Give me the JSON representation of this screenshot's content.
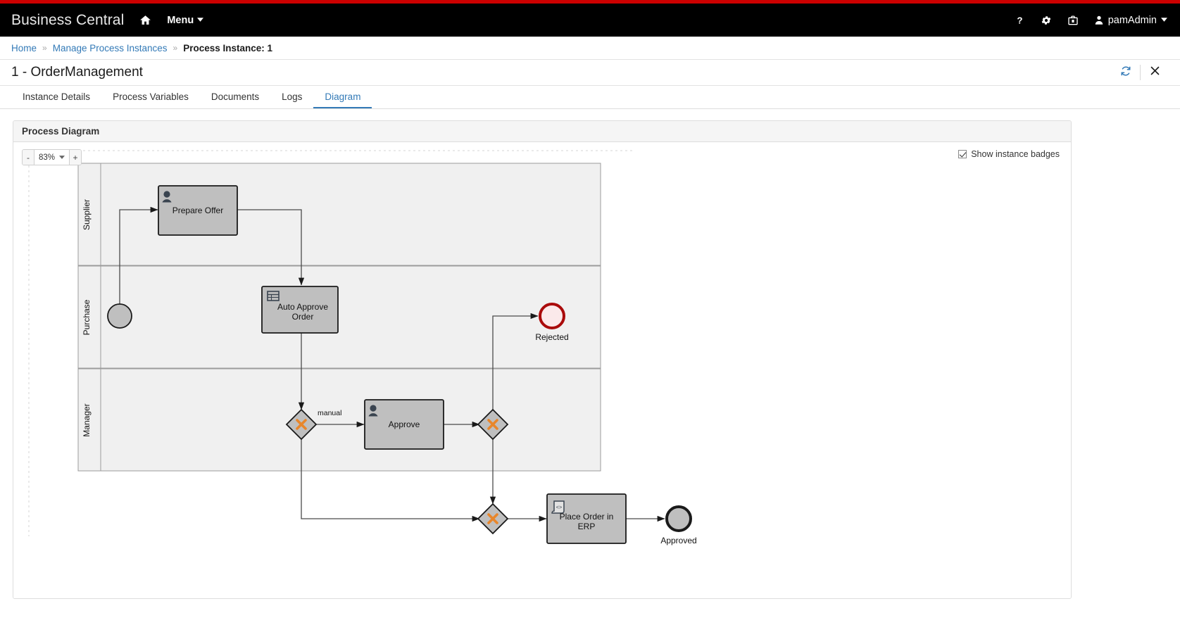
{
  "masthead": {
    "brand": "Business Central",
    "home_icon": "home-icon",
    "menu_label": "Menu",
    "help_icon": "question-mark-icon",
    "settings_icon": "gear-icon",
    "tasks_icon": "briefcase-icon",
    "user_icon": "person-icon",
    "user_name": "pamAdmin",
    "caret": "⌄"
  },
  "breadcrumb": {
    "home": "Home",
    "sep": "»",
    "manage": "Manage Process Instances",
    "current": "Process Instance: 1"
  },
  "titlebar": {
    "title": "1 - OrderManagement",
    "refresh_icon": "refresh-icon",
    "close_icon": "close-icon"
  },
  "tabs": [
    {
      "label": "Instance Details",
      "active": false
    },
    {
      "label": "Process Variables",
      "active": false
    },
    {
      "label": "Documents",
      "active": false
    },
    {
      "label": "Logs",
      "active": false
    },
    {
      "label": "Diagram",
      "active": true
    }
  ],
  "panel": {
    "heading": "Process Diagram",
    "zoom": {
      "minus": "-",
      "level": "83%",
      "caret": "⌄",
      "plus": "+"
    },
    "badges": {
      "label": "Show instance badges",
      "checked": true
    }
  },
  "colors": {
    "accent": "#337ab7",
    "brand_red": "#cc0000",
    "masthead": "#000000",
    "shape_fill": "#bfbfbf",
    "lane_fill": "#f0f0f0",
    "gateway_x": "#e8862b",
    "rejected_stroke": "#aa0b0b",
    "rejected_fill": "#fbe9ea",
    "approved_stroke": "#111111",
    "approved_fill": "#bfbfbf"
  },
  "diagram": {
    "lanes": [
      {
        "id": "lane-supplier",
        "title": "Supplier"
      },
      {
        "id": "lane-purchase",
        "title": "Purchase"
      },
      {
        "id": "lane-manager",
        "title": "Manager"
      }
    ],
    "nodes": [
      {
        "id": "start-event",
        "type": "start-event",
        "label": "",
        "lane": "Purchase"
      },
      {
        "id": "prepare-offer",
        "type": "user-task",
        "label": "Prepare Offer",
        "lane": "Supplier"
      },
      {
        "id": "auto-approve",
        "type": "business-rule-task",
        "label": "Auto Approve Order",
        "lane": "Purchase"
      },
      {
        "id": "gateway-split",
        "type": "exclusive-gateway",
        "label": "",
        "lane": "Manager"
      },
      {
        "id": "approve",
        "type": "user-task",
        "label": "Approve",
        "lane": "Manager"
      },
      {
        "id": "gateway-decision",
        "type": "exclusive-gateway",
        "label": "",
        "lane": "Manager"
      },
      {
        "id": "rejected",
        "type": "end-event-error",
        "label": "Rejected",
        "lane": "Purchase"
      },
      {
        "id": "gateway-join",
        "type": "exclusive-gateway",
        "label": "",
        "lane": ""
      },
      {
        "id": "place-order-erp",
        "type": "script-task",
        "label": "Place Order in ERP",
        "lane": ""
      },
      {
        "id": "approved",
        "type": "end-event",
        "label": "Approved",
        "lane": ""
      }
    ],
    "flows": [
      {
        "from": "start-event",
        "to": "prepare-offer",
        "label": ""
      },
      {
        "from": "prepare-offer",
        "to": "auto-approve",
        "label": ""
      },
      {
        "from": "auto-approve",
        "to": "gateway-split",
        "label": ""
      },
      {
        "from": "gateway-split",
        "to": "approve",
        "label": "manual"
      },
      {
        "from": "gateway-split",
        "to": "gateway-join",
        "label": ""
      },
      {
        "from": "approve",
        "to": "gateway-decision",
        "label": ""
      },
      {
        "from": "gateway-decision",
        "to": "rejected",
        "label": ""
      },
      {
        "from": "gateway-decision",
        "to": "gateway-join",
        "label": ""
      },
      {
        "from": "gateway-join",
        "to": "place-order-erp",
        "label": ""
      },
      {
        "from": "place-order-erp",
        "to": "approved",
        "label": ""
      }
    ]
  }
}
